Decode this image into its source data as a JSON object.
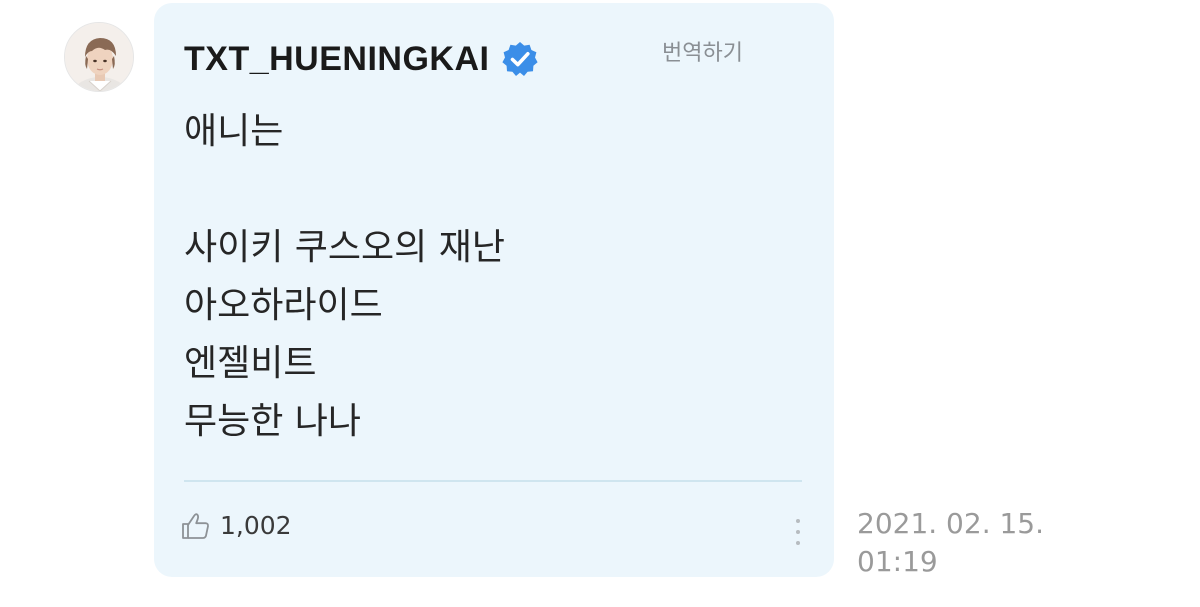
{
  "post": {
    "username": "TXT_HUENINGKAI",
    "verified_icon": "verified-badge-icon",
    "translate_label": "번역하기",
    "message_lines": [
      "애니는",
      "",
      "사이키 쿠스오의 재난",
      "아오하라이드",
      "엔젤비트",
      "무능한 나나"
    ],
    "like_icon": "thumbs-up-icon",
    "like_count": "1,002",
    "more_icon": "vertical-ellipsis-icon",
    "date": "2021. 02. 15.",
    "time": "01:19"
  },
  "colors": {
    "bubble_background": "#ecf6fc",
    "verified_blue": "#3b8ee8",
    "divider": "#cfe5ef",
    "timestamp_text": "#9a9a9a"
  }
}
